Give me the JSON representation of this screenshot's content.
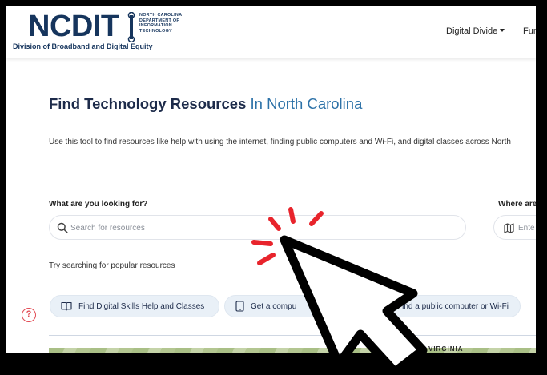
{
  "header": {
    "logo_word": "NCDIT",
    "logo_sub_lines": [
      "NORTH CAROLINA",
      "DEPARTMENT OF",
      "INFORMATION",
      "TECHNOLOGY"
    ],
    "logo_tagline": "Division of Broadband and Digital Equity",
    "nav": {
      "digital_divide": "Digital Divide",
      "truncated_item": "Fun"
    }
  },
  "page": {
    "title_main": "Find Technology Resources",
    "title_accent": "In North Carolina",
    "intro": "Use this tool to find resources like help with using the internet, finding public computers and Wi-Fi, and digital classes across North"
  },
  "search": {
    "what_label": "What are you looking for?",
    "what_placeholder": "Search for resources",
    "where_label": "Where are",
    "where_placeholder": "Ente"
  },
  "suggestions": {
    "label": "Try searching for popular resources",
    "items": [
      {
        "label": "Find Digital Skills Help and Classes",
        "icon": "book-icon"
      },
      {
        "label": "Get a compu",
        "icon": "tablet-icon"
      },
      {
        "label": "Find a public computer or Wi-Fi",
        "icon": ""
      }
    ]
  },
  "help": {
    "glyph": "?"
  },
  "map": {
    "label": "VIRGINIA"
  },
  "colors": {
    "brand_navy": "#16355d",
    "accent_blue": "#2d72a8",
    "pill_bg": "#e9f0f7",
    "help_red": "#e24b54",
    "click_burst_red": "#e8242c"
  },
  "overlay": {
    "cursor": "pointer-arrow-icon",
    "effect": "click-burst-icon"
  }
}
